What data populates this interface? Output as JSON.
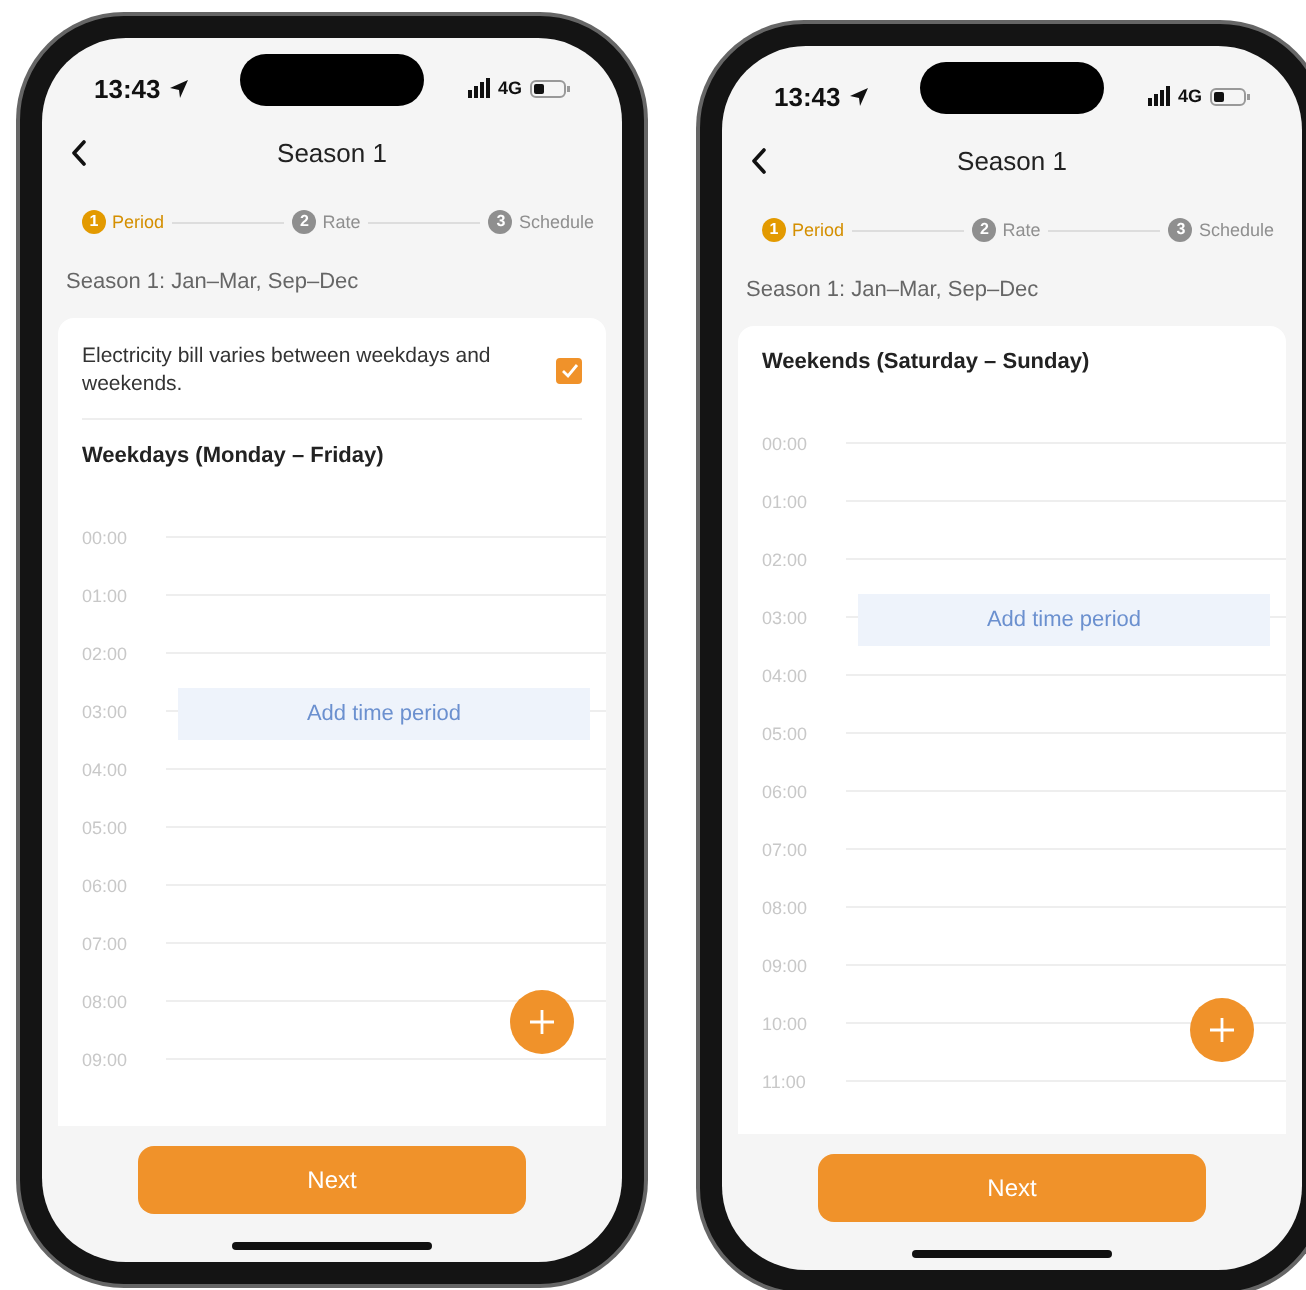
{
  "phones": [
    {
      "status_bar": {
        "time": "13:43",
        "network": "4G"
      },
      "nav": {
        "title": "Season 1"
      },
      "steps": [
        {
          "number": "1",
          "label": "Period",
          "selected": true
        },
        {
          "number": "2",
          "label": "Rate",
          "selected": false
        },
        {
          "number": "3",
          "label": "Schedule",
          "selected": false
        }
      ],
      "season_summary": "Season 1: Jan–Mar, Sep–Dec",
      "option": {
        "label": "Electricity bill varies between weekdays and weekends.",
        "checked": true
      },
      "section_title": "Weekdays (Monday – Friday)",
      "times": [
        "00:00",
        "01:00",
        "02:00",
        "03:00",
        "04:00",
        "05:00",
        "06:00",
        "07:00",
        "08:00",
        "09:00"
      ],
      "add_period": "Add time period",
      "next_button": "Next"
    },
    {
      "status_bar": {
        "time": "13:43",
        "network": "4G"
      },
      "nav": {
        "title": "Season 1"
      },
      "steps": [
        {
          "number": "1",
          "label": "Period",
          "selected": true
        },
        {
          "number": "2",
          "label": "Rate",
          "selected": false
        },
        {
          "number": "3",
          "label": "Schedule",
          "selected": false
        }
      ],
      "season_summary": "Season 1: Jan–Mar, Sep–Dec",
      "section_title": "Weekends (Saturday – Sunday)",
      "times": [
        "00:00",
        "01:00",
        "02:00",
        "03:00",
        "04:00",
        "05:00",
        "06:00",
        "07:00",
        "08:00",
        "09:00",
        "10:00",
        "11:00"
      ],
      "add_period": "Add time period",
      "next_button": "Next"
    }
  ]
}
